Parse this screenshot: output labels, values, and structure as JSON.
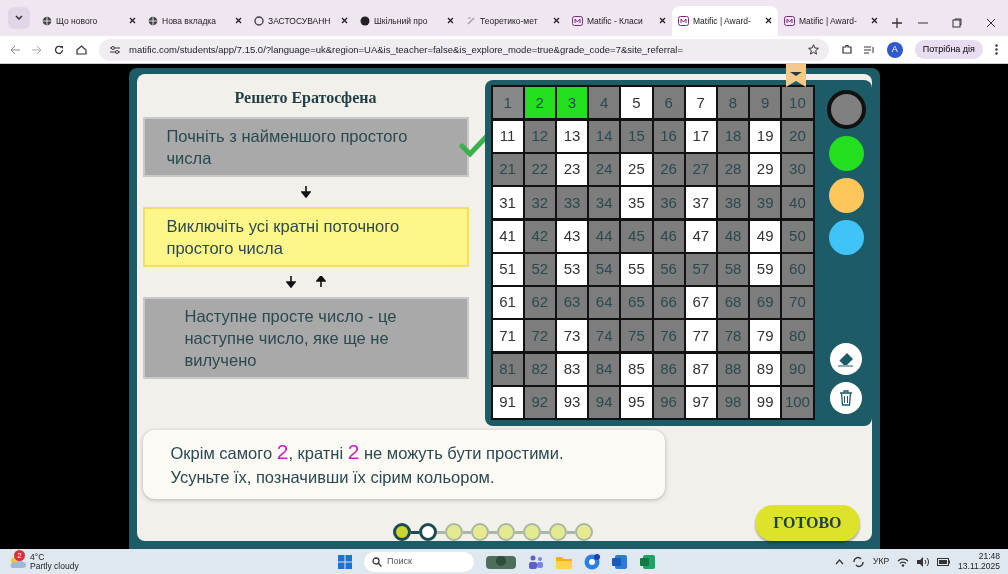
{
  "browser": {
    "tabs": [
      {
        "title": "Що нового",
        "selected": false
      },
      {
        "title": "Нова вкладка",
        "selected": false
      },
      {
        "title": "ЗАСТОСУВАНН",
        "selected": false
      },
      {
        "title": "Шкільний про",
        "selected": false
      },
      {
        "title": "Теоретико-мет",
        "selected": false
      },
      {
        "title": "Matific - Класи",
        "selected": false
      },
      {
        "title": "Matific | Award-",
        "selected": true
      },
      {
        "title": "Matific | Award-",
        "selected": false
      }
    ],
    "address": "matific.com/students/app/7.15.0/?language=uk&region=UA&is_teacher=false&is_explore_mode=true&grade_code=7&site_referral=",
    "profile_initial": "A",
    "action_button": "Потрібна дія"
  },
  "app": {
    "title": "Решето Ератосфена",
    "steps": [
      {
        "text": "Почніть з найменшого простого числа",
        "highlighted": false,
        "checked": true
      },
      {
        "text": "Виключіть усі кратні поточного простого числа",
        "highlighted": true,
        "checked": false
      },
      {
        "text": "Наступне просте число - це наступне число, яке ще не вилучено",
        "highlighted": false,
        "checked": false
      }
    ],
    "grid": [
      {
        "label": "1",
        "color": "#888888"
      },
      {
        "label": "2",
        "color": "#22e01f"
      },
      {
        "label": "3",
        "color": "#22e01f"
      },
      {
        "label": "4",
        "color": "#7d7d7d"
      },
      {
        "label": "5",
        "color": "#ffffff"
      },
      {
        "label": "6",
        "color": "#7d7d7d"
      },
      {
        "label": "7",
        "color": "#ffffff"
      },
      {
        "label": "8",
        "color": "#7d7d7d"
      },
      {
        "label": "9",
        "color": "#7d7d7d"
      },
      {
        "label": "10",
        "color": "#7d7d7d"
      },
      {
        "label": "11",
        "color": "#ffffff"
      },
      {
        "label": "12",
        "color": "#7d7d7d"
      },
      {
        "label": "13",
        "color": "#ffffff"
      },
      {
        "label": "14",
        "color": "#7d7d7d"
      },
      {
        "label": "15",
        "color": "#7d7d7d"
      },
      {
        "label": "16",
        "color": "#7d7d7d"
      },
      {
        "label": "17",
        "color": "#ffffff"
      },
      {
        "label": "18",
        "color": "#7d7d7d"
      },
      {
        "label": "19",
        "color": "#ffffff"
      },
      {
        "label": "20",
        "color": "#7d7d7d"
      },
      {
        "label": "21",
        "color": "#7d7d7d"
      },
      {
        "label": "22",
        "color": "#7d7d7d"
      },
      {
        "label": "23",
        "color": "#ffffff"
      },
      {
        "label": "24",
        "color": "#7d7d7d"
      },
      {
        "label": "25",
        "color": "#ffffff"
      },
      {
        "label": "26",
        "color": "#7d7d7d"
      },
      {
        "label": "27",
        "color": "#7d7d7d"
      },
      {
        "label": "28",
        "color": "#7d7d7d"
      },
      {
        "label": "29",
        "color": "#ffffff"
      },
      {
        "label": "30",
        "color": "#7d7d7d"
      },
      {
        "label": "31",
        "color": "#ffffff"
      },
      {
        "label": "32",
        "color": "#7d7d7d"
      },
      {
        "label": "33",
        "color": "#7d7d7d"
      },
      {
        "label": "34",
        "color": "#7d7d7d"
      },
      {
        "label": "35",
        "color": "#ffffff"
      },
      {
        "label": "36",
        "color": "#7d7d7d"
      },
      {
        "label": "37",
        "color": "#ffffff"
      },
      {
        "label": "38",
        "color": "#7d7d7d"
      },
      {
        "label": "39",
        "color": "#7d7d7d"
      },
      {
        "label": "40",
        "color": "#7d7d7d"
      },
      {
        "label": "41",
        "color": "#ffffff"
      },
      {
        "label": "42",
        "color": "#7d7d7d"
      },
      {
        "label": "43",
        "color": "#ffffff"
      },
      {
        "label": "44",
        "color": "#7d7d7d"
      },
      {
        "label": "45",
        "color": "#7d7d7d"
      },
      {
        "label": "46",
        "color": "#7d7d7d"
      },
      {
        "label": "47",
        "color": "#ffffff"
      },
      {
        "label": "48",
        "color": "#7d7d7d"
      },
      {
        "label": "49",
        "color": "#ffffff"
      },
      {
        "label": "50",
        "color": "#7d7d7d"
      },
      {
        "label": "51",
        "color": "#ffffff"
      },
      {
        "label": "52",
        "color": "#7d7d7d"
      },
      {
        "label": "53",
        "color": "#ffffff"
      },
      {
        "label": "54",
        "color": "#7d7d7d"
      },
      {
        "label": "55",
        "color": "#ffffff"
      },
      {
        "label": "56",
        "color": "#7d7d7d"
      },
      {
        "label": "57",
        "color": "#7d7d7d"
      },
      {
        "label": "58",
        "color": "#7d7d7d"
      },
      {
        "label": "59",
        "color": "#ffffff"
      },
      {
        "label": "60",
        "color": "#7d7d7d"
      },
      {
        "label": "61",
        "color": "#ffffff"
      },
      {
        "label": "62",
        "color": "#7d7d7d"
      },
      {
        "label": "63",
        "color": "#7d7d7d"
      },
      {
        "label": "64",
        "color": "#7d7d7d"
      },
      {
        "label": "65",
        "color": "#7d7d7d"
      },
      {
        "label": "66",
        "color": "#7d7d7d"
      },
      {
        "label": "67",
        "color": "#ffffff"
      },
      {
        "label": "68",
        "color": "#7d7d7d"
      },
      {
        "label": "69",
        "color": "#7d7d7d"
      },
      {
        "label": "70",
        "color": "#7d7d7d"
      },
      {
        "label": "71",
        "color": "#ffffff"
      },
      {
        "label": "72",
        "color": "#7d7d7d"
      },
      {
        "label": "73",
        "color": "#ffffff"
      },
      {
        "label": "74",
        "color": "#7d7d7d"
      },
      {
        "label": "75",
        "color": "#7d7d7d"
      },
      {
        "label": "76",
        "color": "#7d7d7d"
      },
      {
        "label": "77",
        "color": "#ffffff"
      },
      {
        "label": "78",
        "color": "#7d7d7d"
      },
      {
        "label": "79",
        "color": "#ffffff"
      },
      {
        "label": "80",
        "color": "#7d7d7d"
      },
      {
        "label": "81",
        "color": "#7d7d7d"
      },
      {
        "label": "82",
        "color": "#7d7d7d"
      },
      {
        "label": "83",
        "color": "#ffffff"
      },
      {
        "label": "84",
        "color": "#7d7d7d"
      },
      {
        "label": "85",
        "color": "#ffffff"
      },
      {
        "label": "86",
        "color": "#7d7d7d"
      },
      {
        "label": "87",
        "color": "#ffffff"
      },
      {
        "label": "88",
        "color": "#7d7d7d"
      },
      {
        "label": "89",
        "color": "#ffffff"
      },
      {
        "label": "90",
        "color": "#7d7d7d"
      },
      {
        "label": "91",
        "color": "#ffffff"
      },
      {
        "label": "92",
        "color": "#7d7d7d"
      },
      {
        "label": "93",
        "color": "#ffffff"
      },
      {
        "label": "94",
        "color": "#7d7d7d"
      },
      {
        "label": "95",
        "color": "#ffffff"
      },
      {
        "label": "96",
        "color": "#7d7d7d"
      },
      {
        "label": "97",
        "color": "#ffffff"
      },
      {
        "label": "98",
        "color": "#7d7d7d"
      },
      {
        "label": "99",
        "color": "#ffffff"
      },
      {
        "label": "100",
        "color": "#7d7d7d"
      }
    ],
    "palette": [
      {
        "color": "#808080",
        "selected": true
      },
      {
        "color": "#22e01f",
        "selected": false
      },
      {
        "color": "#ffc65c",
        "selected": false
      },
      {
        "color": "#40c4f8",
        "selected": false
      }
    ],
    "message": [
      [
        {
          "text": "Окрім самого ",
          "highlight": false
        },
        {
          "text": "2",
          "highlight": true
        },
        {
          "text": ", кратні ",
          "highlight": false
        },
        {
          "text": "2",
          "highlight": true
        },
        {
          "text": " не можуть бути простими.",
          "highlight": false
        }
      ],
      [
        {
          "text": "Усуньте їх, позначивши їх сірим кольором.",
          "highlight": false
        }
      ]
    ],
    "progress": [
      {
        "kind": "done"
      },
      {
        "kind": "current"
      },
      {
        "kind": "todo"
      },
      {
        "kind": "todo"
      },
      {
        "kind": "todo"
      },
      {
        "kind": "todo"
      },
      {
        "kind": "todo"
      },
      {
        "kind": "todo"
      }
    ],
    "done_button": "ГОТОВО"
  },
  "taskbar": {
    "notification_count": "2",
    "weather_temp": "4°C",
    "weather_text": "Partly cloudy",
    "search_placeholder": "Поиск",
    "language": "УКР",
    "time": "21:48",
    "date": "13.11.2025"
  }
}
